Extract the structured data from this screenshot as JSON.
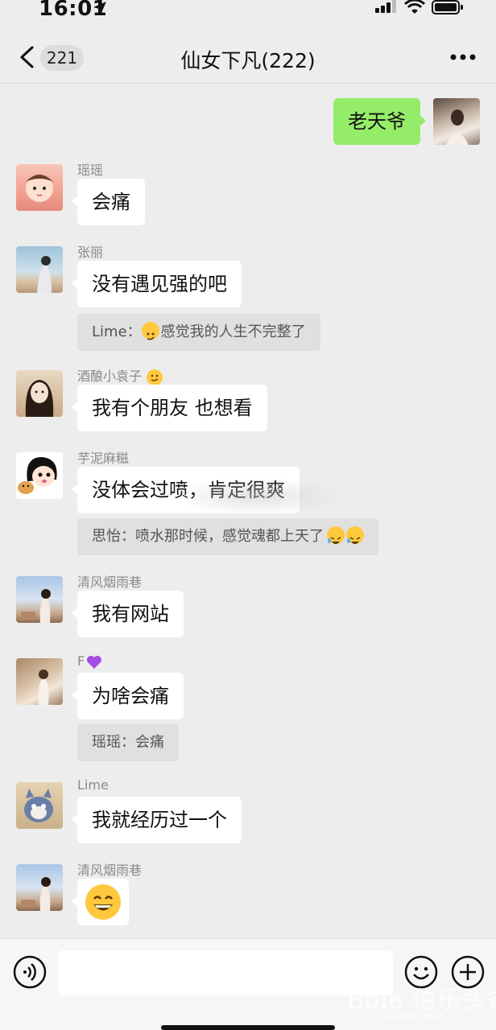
{
  "status_bar": {
    "time": "16:01"
  },
  "header": {
    "back_count": "221",
    "title": "仙女下凡(222)"
  },
  "messages": [
    {
      "sender": "",
      "text": "老天爷",
      "mine": true
    },
    {
      "sender": "瑶瑶",
      "text": "会痛"
    },
    {
      "sender": "张丽",
      "text": "没有遇见强的吧",
      "quote_prefix": "Lime：",
      "quote_text": "感觉我的人生不完整了"
    },
    {
      "sender": "酒酿小袁子",
      "text": "我有个朋友 也想看"
    },
    {
      "sender": "芋泥麻糍",
      "text": "没体会过喷，肯定很爽",
      "quote_text": "思怡：喷水那时候，感觉魂都上天了"
    },
    {
      "sender": "清风烟雨巷",
      "text": "我有网站"
    },
    {
      "sender": "F",
      "text": "为啥会痛",
      "quote_text": "瑶瑶：会痛"
    },
    {
      "sender": "Lime",
      "text": "我就经历过一个"
    },
    {
      "sender": "清风烟雨巷",
      "text": "😄"
    }
  ],
  "watermark": {
    "text": "Bole 伯乐头条",
    "sub": "bolett.com"
  },
  "colors": {
    "background": "#ededed",
    "my_bubble": "#95ec69",
    "their_bubble": "#ffffff",
    "quote_bg": "#e0e0e0",
    "emoji_yellow": "#ffc83d",
    "heart_purple": "#a64ce6"
  },
  "icons": [
    "location-arrow-icon",
    "signal-icon",
    "wifi-icon",
    "battery-icon",
    "chevron-left-icon",
    "more-dots-icon",
    "voice-icon",
    "emoji-icon",
    "plus-icon",
    "purple-heart-icon",
    "smirk-emoji-icon",
    "laugh-cry-emoji-icon",
    "grin-emoji-icon"
  ]
}
